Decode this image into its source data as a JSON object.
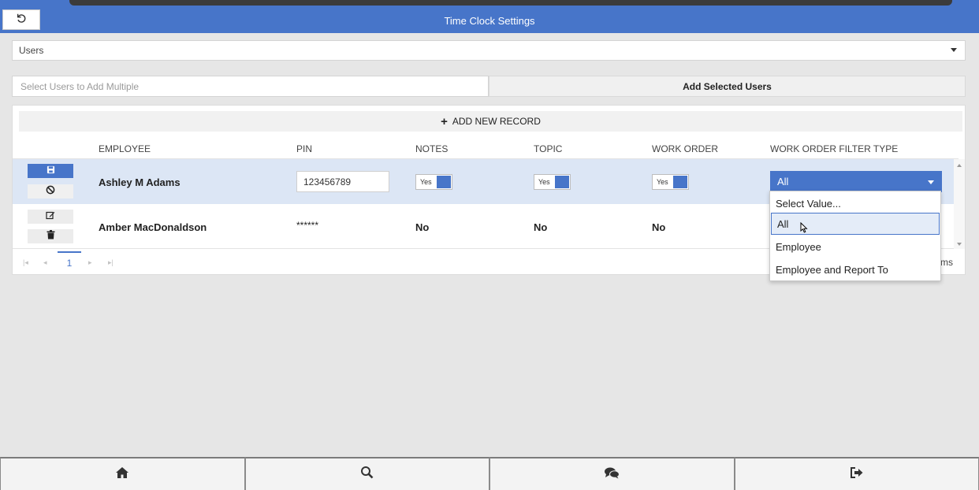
{
  "header": {
    "title": "Time Clock Settings",
    "back_icon": "undo-icon"
  },
  "users_select": {
    "value": "Users",
    "icon": "caret-down-icon"
  },
  "multi_add": {
    "placeholder": "Select Users to Add Multiple",
    "button_label": "Add Selected Users"
  },
  "grid": {
    "add_record_label": "ADD NEW RECORD",
    "columns": [
      "EMPLOYEE",
      "PIN",
      "NOTES",
      "TOPIC",
      "WORK ORDER",
      "WORK ORDER FILTER TYPE"
    ],
    "rows": [
      {
        "employee": "Ashley M Adams",
        "pin": "123456789",
        "notes": "Yes",
        "topic": "Yes",
        "work_order": "Yes",
        "work_order_filter_type": "All",
        "mode": "edit",
        "commands": [
          "save-icon",
          "cancel-icon"
        ]
      },
      {
        "employee": "Amber MacDonaldson",
        "pin": "******",
        "notes": "No",
        "topic": "No",
        "work_order": "No",
        "mode": "view",
        "commands": [
          "edit-icon",
          "delete-icon"
        ]
      }
    ],
    "pager": {
      "current_page": "1",
      "items_label": "ms"
    }
  },
  "filter_dropdown": {
    "options": [
      "Select Value...",
      "All",
      "Employee",
      "Employee and Report To"
    ],
    "selected": "All"
  },
  "bottom_nav": [
    {
      "name": "home",
      "icon": "home-icon"
    },
    {
      "name": "search",
      "icon": "search-icon"
    },
    {
      "name": "chat",
      "icon": "chat-icon"
    },
    {
      "name": "logout",
      "icon": "logout-icon"
    }
  ],
  "colors": {
    "accent": "#4775c9",
    "selected_row": "#dce6f5",
    "background": "#e6e6e6"
  }
}
